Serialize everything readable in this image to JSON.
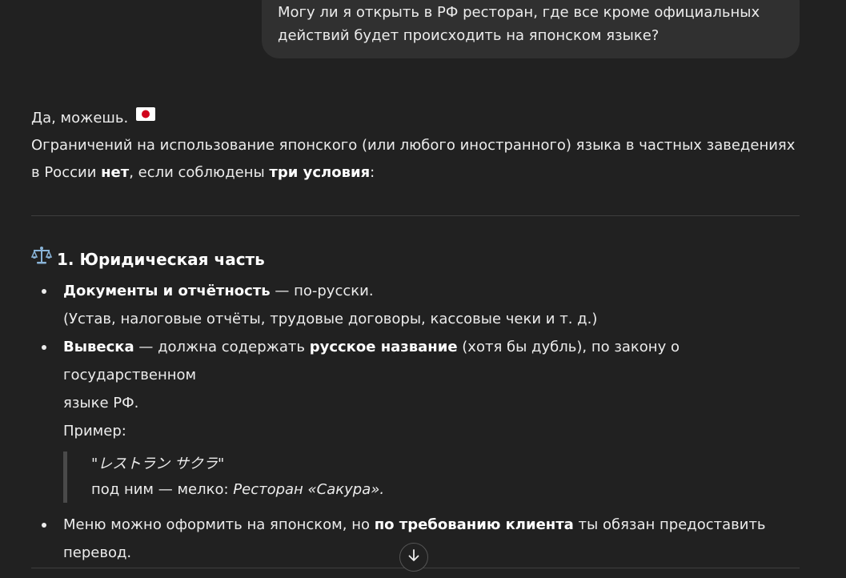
{
  "user_message": {
    "line1": "Могу ли я открыть в РФ ресторан, где все кроме официальных",
    "line2": "действий будет происходить на японском языке?"
  },
  "assistant": {
    "intro_text": "Да, можешь.",
    "flag_icon": "japan-flag-icon",
    "para_part1": "Ограничений на использование японского (или любого иностранного) языка в частных заведениях",
    "para_part2": "в России ",
    "para_bold1": "нет",
    "para_part3": ", если соблюдены ",
    "para_bold2": "три условия",
    "para_part4": ":"
  },
  "section": {
    "icon": "scales-icon",
    "title": "1. Юридическая часть"
  },
  "bullets": {
    "b1_bold": "Документы и отчётность",
    "b1_text": " — по-русски.",
    "b1_line2": "(Устав, налоговые отчёты, трудовые договоры, кассовые чеки и т. д.)",
    "b2_bold": "Вывеска",
    "b2_text": " — должна содержать ",
    "b2_bold2": "русское название",
    "b2_text2": " (хотя бы дубль), по закону о государственном",
    "b2_line2": "языке РФ.",
    "b2_example": "Пример:",
    "quote_line1": "\"レストラン サクラ\"",
    "quote_line2_prefix": "под ним — мелко: ",
    "quote_line2_italic": "Ресторан «Сакура».",
    "b3_text": "Меню можно оформить на японском, но ",
    "b3_bold": "по требованию клиента",
    "b3_text2": " ты обязан предоставить",
    "b3_line2": "перевод."
  },
  "controls": {
    "scroll_down_icon": "arrow-down-icon"
  }
}
